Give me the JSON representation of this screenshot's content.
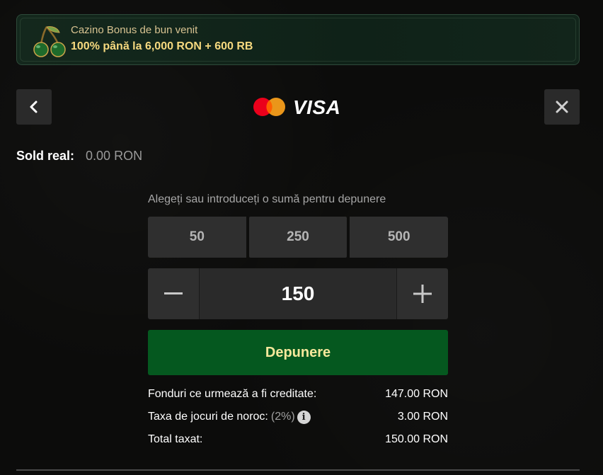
{
  "bonus": {
    "title": "Cazino Bonus de bun venit",
    "subtitle": "100% până la 6,000 RON + 600 RB",
    "icon": "cherry-icon"
  },
  "header": {
    "back_icon": "chevron-left-icon",
    "close_icon": "close-icon",
    "brand_text": "VISA",
    "mastercard_colors": [
      "#eb001b",
      "#f79e1b"
    ]
  },
  "balance": {
    "label": "Sold real:",
    "value": "0.00 RON"
  },
  "deposit": {
    "prompt": "Alegeți sau introduceți o sumă pentru depunere",
    "presets": [
      "50",
      "250",
      "500"
    ],
    "amount": "150",
    "minus_icon": "minus-icon",
    "plus_icon": "plus-icon",
    "button_label": "Depunere"
  },
  "summary": {
    "rows": [
      {
        "label": "Fonduri ce urmează a fi creditate:",
        "extra": "",
        "value": "147.00 RON"
      },
      {
        "label": "Taxa de jocuri de noroc:",
        "extra": "(2%)",
        "value": "3.00 RON"
      },
      {
        "label": "Total taxat:",
        "extra": "",
        "value": "150.00 RON"
      }
    ],
    "info_glyph": "i"
  },
  "colors": {
    "accent_green": "#05581f",
    "button_text": "#f7e89c",
    "bonus_gold": "#f6d97f"
  }
}
